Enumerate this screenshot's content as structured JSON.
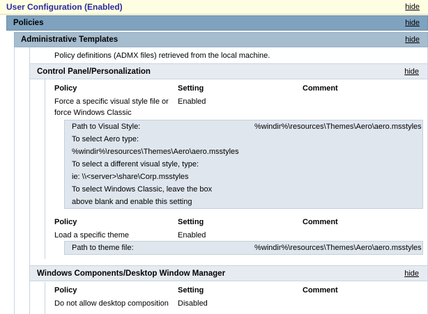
{
  "user_configuration": {
    "title": "User Configuration (Enabled)",
    "hide": "hide"
  },
  "policies": {
    "title": "Policies",
    "hide": "hide"
  },
  "admin_templates": {
    "title": "Administrative Templates",
    "hide": "hide",
    "description": "Policy definitions (ADMX files) retrieved from the local machine."
  },
  "control_panel": {
    "title": "Control Panel/Personalization",
    "hide": "hide",
    "columns": [
      "Policy",
      "Setting",
      "Comment"
    ],
    "policy1": {
      "name_line1": "Force a specific visual style file or",
      "name_line2": "force Windows Classic",
      "setting": "Enabled",
      "detail_label": "Path to Visual Style:",
      "detail_value": "%windir%\\resources\\Themes\\Aero\\aero.msstyles",
      "help_lines": [
        "To select Aero type:",
        "%windir%\\resources\\Themes\\Aero\\aero.msstyles",
        "To select a different visual style, type:",
        "ie: \\\\<server>\\share\\Corp.msstyles",
        "To select Windows Classic, leave the box",
        "above blank and enable this setting"
      ]
    },
    "policy2": {
      "name": "Load a specific theme",
      "setting": "Enabled",
      "detail_label": "Path to theme file:",
      "detail_value": "%windir%\\resources\\Themes\\Aero\\aero.msstyles"
    }
  },
  "dwm": {
    "title": "Windows Components/Desktop Window Manager",
    "hide": "hide",
    "columns": [
      "Policy",
      "Setting",
      "Comment"
    ],
    "policy1": {
      "name": "Do not allow desktop composition",
      "setting": "Disabled"
    }
  }
}
